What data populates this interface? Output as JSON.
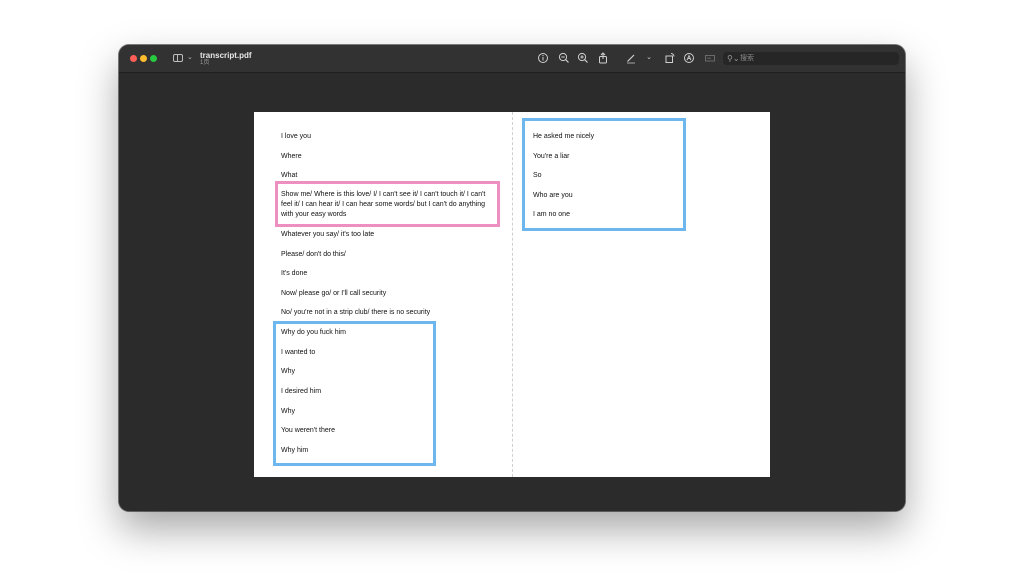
{
  "window": {
    "title": "transcript.pdf",
    "subtitle": "1页",
    "search_placeholder": "搜索"
  },
  "toolbar": {
    "icons": [
      "info-icon",
      "zoom-out-icon",
      "zoom-in-icon",
      "share-icon",
      "markup-pen-icon",
      "chevron-down-icon",
      "rotate-icon",
      "annotate-icon",
      "form-icon",
      "search-icon"
    ]
  },
  "colors": {
    "window_bg": "#2b2b2b",
    "highlight_pink": "#ee8fc2",
    "highlight_blue": "#6db6ee"
  },
  "left_column": [
    "I love you",
    "Where",
    "What",
    "Show me/ Where is this love/ I/ I can't see it/ I can't touch it/ I can't feel it/ I can hear it/ I can hear some words/ but I can't do anything with your easy words",
    "Whatever you say/ it's too late",
    "Please/ don't do this/",
    "It's done",
    "Now/ please go/ or I'll call security",
    "No/ you're not in a strip club/ there is no security",
    "Why do you fuck him",
    "I wanted to",
    "Why",
    "I desired him",
    "Why",
    "You weren't there",
    "Why him"
  ],
  "right_column": [
    "He asked me nicely",
    "You're a liar",
    "So",
    "Who are you",
    "I am no one"
  ]
}
